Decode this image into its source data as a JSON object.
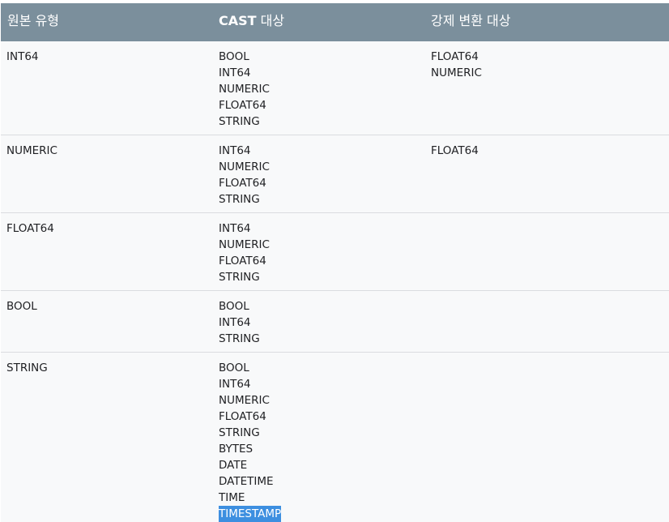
{
  "header": {
    "col1": "원본 유형",
    "col2_bold": "CAST",
    "col2_rest": " 대상",
    "col3": "강제 변환 대상"
  },
  "rows": [
    {
      "source": "INT64",
      "cast": [
        "BOOL",
        "INT64",
        "NUMERIC",
        "FLOAT64",
        "STRING"
      ],
      "coerce": [
        "FLOAT64",
        "NUMERIC"
      ]
    },
    {
      "source": "NUMERIC",
      "cast": [
        "INT64",
        "NUMERIC",
        "FLOAT64",
        "STRING"
      ],
      "coerce": [
        "FLOAT64"
      ]
    },
    {
      "source": "FLOAT64",
      "cast": [
        "INT64",
        "NUMERIC",
        "FLOAT64",
        "STRING"
      ],
      "coerce": []
    },
    {
      "source": "BOOL",
      "cast": [
        "BOOL",
        "INT64",
        "STRING"
      ],
      "coerce": []
    },
    {
      "source": "STRING",
      "cast": [
        "BOOL",
        "INT64",
        "NUMERIC",
        "FLOAT64",
        "STRING",
        "BYTES",
        "DATE",
        "DATETIME",
        "TIME",
        "TIMESTAMP"
      ],
      "coerce": []
    }
  ],
  "colors": {
    "header_bg": "#7b8f9c",
    "row_bg": "#f8f9fa",
    "selection": "#3d8fe0"
  }
}
